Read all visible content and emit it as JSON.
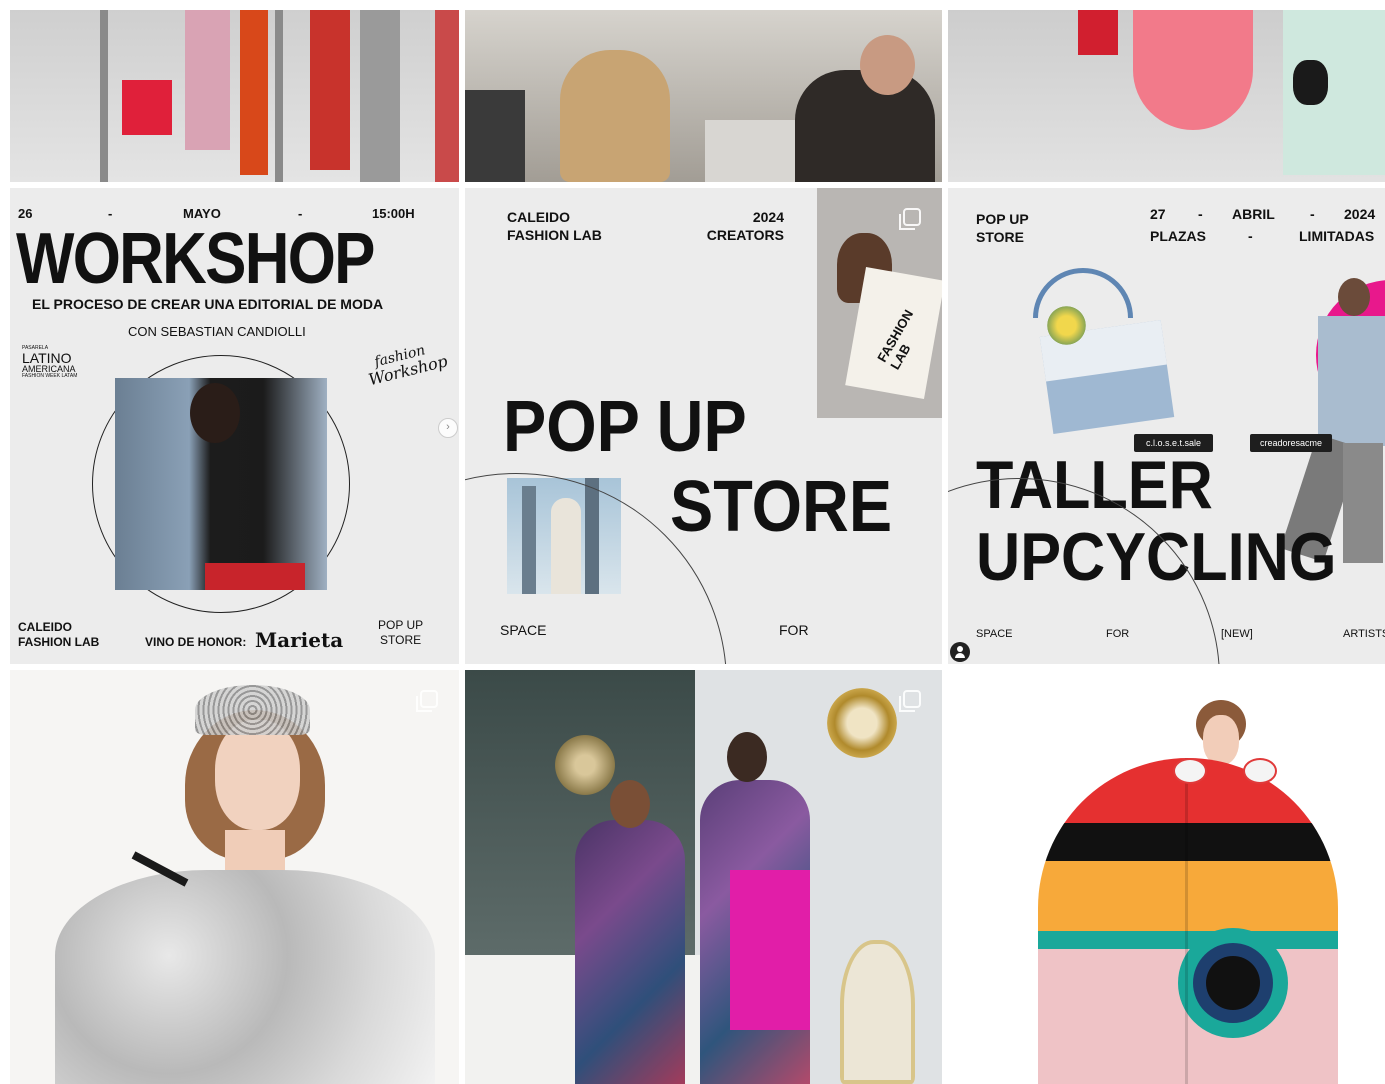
{
  "workshop": {
    "date_day": "26",
    "date_sep1": "-",
    "date_month": "MAYO",
    "date_sep2": "-",
    "time": "15:00H",
    "title": "WORKSHOP",
    "subtitle": "EL PROCESO DE CREAR UNA EDITORIAL DE MODA",
    "presenter": "CON SEBASTIAN  CANDIOLLI",
    "logo_line1": "PASARELA",
    "logo_line2": "LATINO",
    "logo_line3": "AMERICANA",
    "logo_line4": "FASHION WEEK LATAM",
    "script_line1": "fashion",
    "script_line2": "Workshop",
    "footer_left_1": "CALEIDO",
    "footer_left_2": "FASHION LAB",
    "footer_mid": "VINO DE HONOR:",
    "footer_brand": "Marieta",
    "footer_right_1": "POP UP",
    "footer_right_2": "STORE"
  },
  "popup": {
    "brand_1": "CALEIDO",
    "brand_2": "FASHION LAB",
    "year": "2024",
    "creators": "CREATORS",
    "title_1": "POP UP",
    "title_2": "STORE",
    "bag_text": "FASHION LAB",
    "footer_left": "SPACE",
    "footer_right": "FOR"
  },
  "taller": {
    "tag_1": "POP UP",
    "tag_2": "STORE",
    "day": "27",
    "sep1": "-",
    "month": "ABRIL",
    "sep2": "-",
    "year": "2024",
    "plazas": "PLAZAS",
    "sep3": "-",
    "limitadas": "LIMITADAS",
    "handle_1": "c.l.o.s.e.t.sale",
    "handle_2": "creadoresacme",
    "title_1": "TALLER",
    "title_2": "UPCYCLING",
    "footer": [
      "SPACE",
      "FOR",
      "[NEW]",
      "ARTISTS"
    ]
  },
  "colors": {
    "tile_bg": "#efefef",
    "text_dark": "#141414",
    "magenta": "#e8188c",
    "circle_red": "#e53030",
    "circle_orange": "#f7a93a",
    "circle_teal": "#1aa89a",
    "circle_pink": "#efc3c6"
  }
}
